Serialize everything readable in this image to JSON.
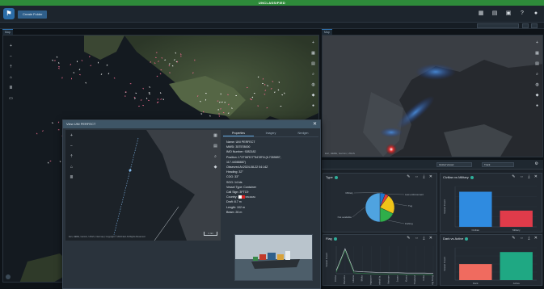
{
  "banner": {
    "text": "UNCLASSIFIED",
    "color": "#2e8b3a"
  },
  "topbar": {
    "create_button": "Create Folder",
    "icons": [
      "grid-icon",
      "table-icon",
      "document-icon",
      "help-icon",
      "user-icon"
    ]
  },
  "left_map": {
    "tab": "Map"
  },
  "right_map": {
    "tab": "Map"
  },
  "popup": {
    "title": "View UNI PERFECT",
    "tabs": [
      "Properties",
      "Imagery",
      "Nextgen"
    ],
    "fields": [
      "Name: UNI PERFECT",
      "MMSI: 357578000",
      "IMO Number: 9282182",
      "Position: 1°37'08\"E/7°54'39\"N (6.7359897,",
      "117.44088887)",
      "Observed At:2024-08-22 04:14Z",
      "Heading: 32°",
      "COG: 33°",
      "SOG: 14 kts",
      "Vessel Type: Container",
      "Call Sign: 3FTC9",
      "Country:",
      "Draft: 8.7 m",
      "Length: 102 m",
      "Beam: 26 m"
    ],
    "country_value": "PANAMA",
    "attribution": "Esri, HERE, Garmin, USGS, Intermap | Copyright © 2024 Esri All Rights Reserved",
    "scale": "1 nm"
  },
  "cards": {
    "type": {
      "title": "Type",
      "chart_data": {
        "type": "pie",
        "categories": [
          "Military",
          "Law enforcement",
          "Tug",
          "Fishing",
          "Not available"
        ],
        "values": [
          6,
          4,
          22,
          18,
          50
        ],
        "colors": [
          "#1f77d0",
          "#e03b3b",
          "#f0c419",
          "#2fae4a",
          "#4fa3e0"
        ]
      }
    },
    "civilian_military": {
      "title": "Civilian vs Military",
      "chart_data": {
        "type": "bar",
        "categories": [
          "Civilian",
          "Military"
        ],
        "values": [
          130,
          60
        ],
        "colors": [
          "#2f8be0",
          "#e03b4a"
        ],
        "ylabel": "Vessel Count"
      }
    },
    "flag": {
      "title": "Flag",
      "chart_data": {
        "type": "line",
        "categories": [
          "China",
          "Panama",
          "Liberia",
          "Malta",
          "Singapore",
          "Marshall Is.",
          "Vietnam",
          "Japan",
          "Korea",
          "Thailand",
          "India",
          "Hong Kong"
        ],
        "values": [
          10,
          80,
          8,
          6,
          5,
          4,
          3,
          3,
          2,
          2,
          2,
          1
        ],
        "ylabel": "Vessel Count"
      }
    },
    "dark_active": {
      "title": "Dark vs Active",
      "chart_data": {
        "type": "bar",
        "categories": [
          "Dark",
          "Active"
        ],
        "values": [
          60,
          105
        ],
        "colors": [
          "#f06b5f",
          "#1fa883"
        ],
        "ylabel": "Vessel Count"
      }
    }
  },
  "dash_toolbar": {
    "selector_label": "Global Vessel",
    "selector_value": "Track"
  },
  "right_map_attribution": "Esri, HERE, Garmin, USGS"
}
